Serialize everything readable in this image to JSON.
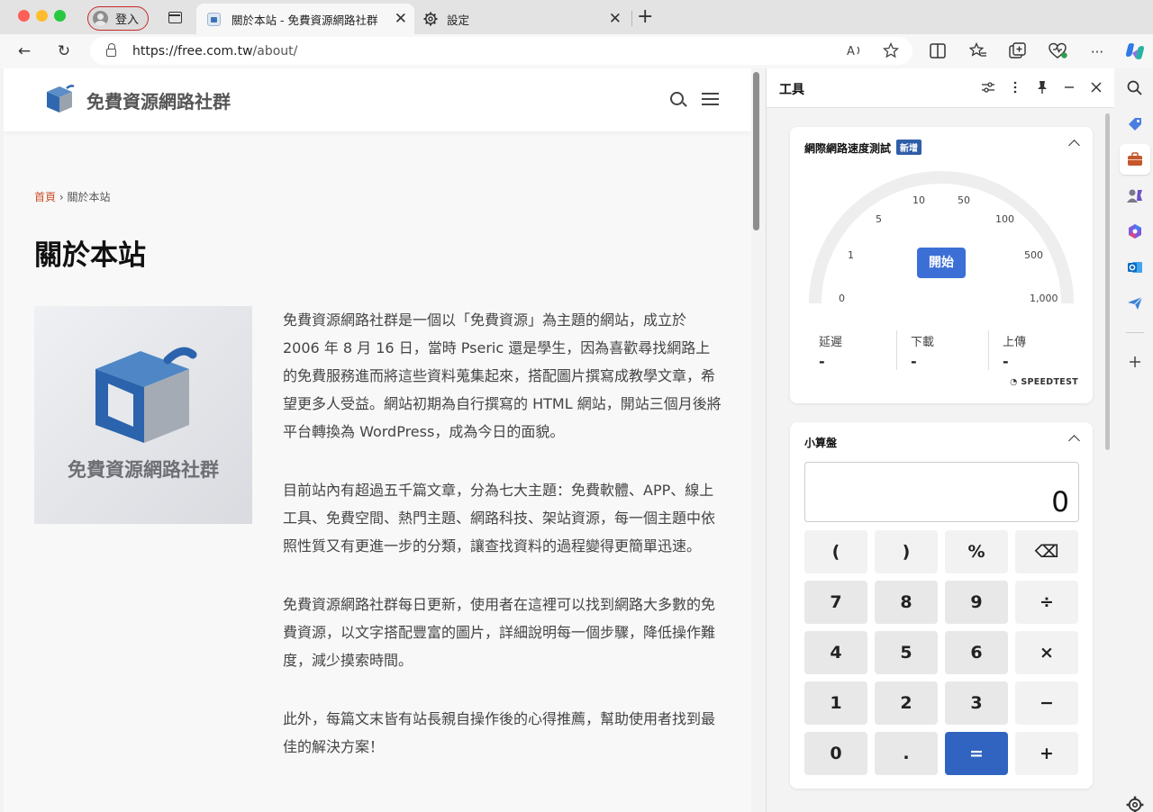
{
  "tabs": {
    "profile_label": "登入",
    "active_title": "關於本站 - 免費資源網路社群",
    "second_title": "設定",
    "close_glyph": "✕",
    "new_tab_glyph": "+"
  },
  "toolbar": {
    "url_host": "https://free.com.tw",
    "url_path": "/about/",
    "back_glyph": "←",
    "reload_glyph": "↻",
    "more_glyph": "···"
  },
  "site": {
    "title": "免費資源網路社群",
    "breadcrumb_home": "首頁",
    "breadcrumb_sep": "›",
    "breadcrumb_current": "關於本站",
    "page_title": "關於本站",
    "image_caption": "免費資源網路社群",
    "paragraphs": [
      "免費資源網路社群是一個以「免費資源」為主題的網站，成立於 2006 年 8 月 16 日，當時 Pseric 還是學生，因為喜歡尋找網路上的免費服務進而將這些資料蒐集起來，搭配圖片撰寫成教學文章，希望更多人受益。網站初期為自行撰寫的 HTML 網站，開站三個月後將平台轉換為 WordPress，成為今日的面貌。",
      "目前站內有超過五千篇文章，分為七大主題：免費軟體、APP、線上工具、免費空間、熱門主題、網路科技、架站資源，每一個主題中依照性質又有更進一步的分類，讓查找資料的過程變得更簡單迅速。",
      "免費資源網路社群每日更新，使用者在這裡可以找到網路大多數的免費資源，以文字搭配豐富的圖片，詳細說明每一個步驟，降低操作難度，減少摸索時間。",
      "此外，每篇文末皆有站長親自操作後的心得推薦，幫助使用者找到最佳的解決方案！"
    ]
  },
  "panel": {
    "title": "工具",
    "speedtest": {
      "title": "網際網路速度測試",
      "badge": "新增",
      "gauge_labels": [
        "0",
        "1",
        "5",
        "10",
        "50",
        "100",
        "500",
        "1,000"
      ],
      "start_label": "開始",
      "stats": [
        {
          "label": "延遲",
          "value": "-"
        },
        {
          "label": "下載",
          "value": "-"
        },
        {
          "label": "上傳",
          "value": "-"
        }
      ],
      "brand": "SPEEDTEST"
    },
    "calculator": {
      "title": "小算盤",
      "display": "0",
      "keys": [
        "(",
        ")",
        "%",
        "⌫",
        "7",
        "8",
        "9",
        "÷",
        "4",
        "5",
        "6",
        "×",
        "1",
        "2",
        "3",
        "−",
        "0",
        ".",
        "=",
        "+"
      ]
    }
  },
  "colors": {
    "accent": "#3b6fd6",
    "breadcrumb_link": "#c8512a",
    "profile_border": "#c62828"
  }
}
